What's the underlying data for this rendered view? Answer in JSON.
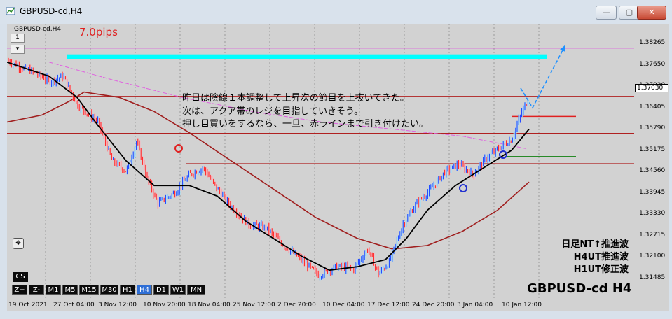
{
  "window": {
    "title": "GBPUSD-cd,H4",
    "minimize_label": "—",
    "restore_label": "▢",
    "close_label": "✕"
  },
  "chart": {
    "symbol_label": "GBPUSD-cd,H4",
    "watermark": "GBPUSD-cd H4",
    "pips_label": "7.0pips",
    "current_price": "1.37030",
    "annotation_lines": [
      "昨日は陰線１本調整して上昇次の節目を上抜いてきた。",
      "次は、アクア帯のレジを目指していきそう。",
      "押し目買いをするなら、一旦、赤ラインまで引き付けたい。"
    ],
    "wave_labels": [
      "日足NT↑推進波",
      "H4UT推進波",
      "H1UT修正波"
    ],
    "colors": {
      "bull": "#1a3cff",
      "bear": "#ff2020",
      "ma_black": "#000000",
      "ma_red": "#a01e1e",
      "ma_magenta": "#e060e0",
      "aqua_band": "#00ffff",
      "hline_red": "#b02020",
      "hline_magenta": "#e020e0",
      "green_line": "#108010",
      "circle_red": "#e02020",
      "circle_blue": "#2030d0"
    }
  },
  "toolbar": {
    "cs_label": "CS",
    "timeframes": [
      "Z+",
      "Z-",
      "M1",
      "M5",
      "M15",
      "M30",
      "H1",
      "H4",
      "D1",
      "W1",
      "MN"
    ],
    "selected": "H4"
  },
  "price_axis": [
    "1.38265",
    "1.37650",
    "1.37030",
    "1.36405",
    "1.35790",
    "1.35175",
    "1.34560",
    "1.33945",
    "1.33330",
    "1.32715",
    "1.32100",
    "1.31485"
  ],
  "time_axis": [
    "19 Oct 2021",
    "27 Oct 04:00",
    "3 Nov 12:00",
    "10 Nov 20:00",
    "18 Nov 04:00",
    "25 Nov 12:00",
    "2 Dec 20:00",
    "10 Dec 04:00",
    "17 Dec 12:00",
    "24 Dec 20:00",
    "3 Jan 04:00",
    "10 Jan 12:00"
  ],
  "chart_data": {
    "type": "candlestick",
    "title": "GBPUSD-cd,H4",
    "ylim": [
      1.3135,
      1.3865
    ],
    "price_levels": {
      "aqua_band": [
        1.3808,
        1.3822
      ],
      "magenta_line": 1.384,
      "red_lines": [
        1.3703,
        1.3598,
        1.3512
      ],
      "red_segment": 1.3646,
      "green_segment": 1.3532
    },
    "close_path": [
      [
        0,
        1.3805
      ],
      [
        20,
        1.3785
      ],
      [
        40,
        1.377
      ],
      [
        60,
        1.3745
      ],
      [
        80,
        1.376
      ],
      [
        100,
        1.368
      ],
      [
        130,
        1.363
      ],
      [
        150,
        1.352
      ],
      [
        170,
        1.349
      ],
      [
        185,
        1.3575
      ],
      [
        200,
        1.347
      ],
      [
        215,
        1.34
      ],
      [
        240,
        1.343
      ],
      [
        260,
        1.348
      ],
      [
        280,
        1.35
      ],
      [
        300,
        1.344
      ],
      [
        320,
        1.339
      ],
      [
        345,
        1.334
      ],
      [
        370,
        1.333
      ],
      [
        395,
        1.328
      ],
      [
        420,
        1.324
      ],
      [
        445,
        1.3195
      ],
      [
        470,
        1.322
      ],
      [
        495,
        1.3215
      ],
      [
        515,
        1.327
      ],
      [
        530,
        1.32
      ],
      [
        545,
        1.323
      ],
      [
        565,
        1.334
      ],
      [
        585,
        1.34
      ],
      [
        605,
        1.344
      ],
      [
        625,
        1.349
      ],
      [
        645,
        1.351
      ],
      [
        665,
        1.348
      ],
      [
        685,
        1.353
      ],
      [
        705,
        1.356
      ],
      [
        720,
        1.358
      ],
      [
        735,
        1.366
      ],
      [
        745,
        1.37
      ]
    ],
    "ma_black": [
      [
        0,
        1.38
      ],
      [
        60,
        1.376
      ],
      [
        100,
        1.37
      ],
      [
        130,
        1.362
      ],
      [
        170,
        1.352
      ],
      [
        210,
        1.345
      ],
      [
        260,
        1.345
      ],
      [
        300,
        1.342
      ],
      [
        340,
        1.335
      ],
      [
        380,
        1.33
      ],
      [
        420,
        1.325
      ],
      [
        460,
        1.321
      ],
      [
        500,
        1.322
      ],
      [
        540,
        1.324
      ],
      [
        570,
        1.33
      ],
      [
        600,
        1.338
      ],
      [
        640,
        1.345
      ],
      [
        680,
        1.35
      ],
      [
        720,
        1.355
      ],
      [
        745,
        1.361
      ]
    ],
    "ma_red": [
      [
        0,
        1.363
      ],
      [
        50,
        1.365
      ],
      [
        90,
        1.369
      ],
      [
        110,
        1.3715
      ],
      [
        160,
        1.37
      ],
      [
        210,
        1.366
      ],
      [
        260,
        1.36
      ],
      [
        320,
        1.352
      ],
      [
        380,
        1.344
      ],
      [
        440,
        1.336
      ],
      [
        500,
        1.33
      ],
      [
        550,
        1.327
      ],
      [
        600,
        1.328
      ],
      [
        650,
        1.332
      ],
      [
        700,
        1.338
      ],
      [
        745,
        1.346
      ]
    ],
    "ma_magenta": [
      [
        60,
        1.38
      ],
      [
        150,
        1.375
      ],
      [
        250,
        1.37
      ],
      [
        350,
        1.366
      ],
      [
        450,
        1.363
      ],
      [
        550,
        1.361
      ],
      [
        650,
        1.359
      ],
      [
        740,
        1.3555
      ]
    ]
  }
}
